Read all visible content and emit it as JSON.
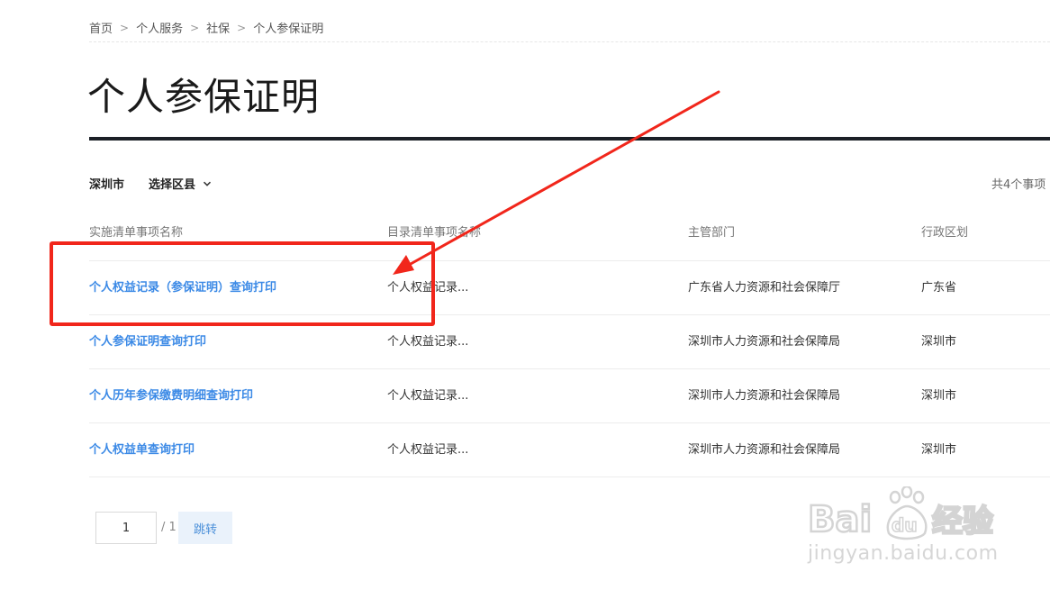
{
  "breadcrumb": {
    "items": [
      "首页",
      "个人服务",
      "社保",
      "个人参保证明"
    ],
    "separator": ">"
  },
  "page_title": "个人参保证明",
  "filters": {
    "city": "深圳市",
    "district_select": "选择区县",
    "total_count": "共4个事项"
  },
  "table": {
    "headers": [
      "实施清单事项名称",
      "目录清单事项名称",
      "主管部门",
      "行政区划"
    ],
    "rows": [
      [
        "个人权益记录（参保证明）查询打印",
        "个人权益记录...",
        "广东省人力资源和社会保障厅",
        "广东省"
      ],
      [
        "个人参保证明查询打印",
        "个人权益记录...",
        "深圳市人力资源和社会保障局",
        "深圳市"
      ],
      [
        "个人历年参保缴费明细查询打印",
        "个人权益记录...",
        "深圳市人力资源和社会保障局",
        "深圳市"
      ],
      [
        "个人权益单查询打印",
        "个人权益记录...",
        "深圳市人力资源和社会保障局",
        "深圳市"
      ]
    ]
  },
  "pagination": {
    "current_page": "1",
    "total_pages": "/ 1",
    "jump_label": "跳转"
  },
  "watermark": {
    "logo_text": "Bai du 经验",
    "url": "jingyan.baidu.com"
  },
  "colors": {
    "link": "#3c8ae6",
    "title_rule": "#1b2027",
    "annotation": "#f1261b",
    "jump_button_bg": "#eaf2fb"
  },
  "icons": {
    "district_dropdown": "chevron-down-icon",
    "breadcrumb_separator": "chevron-right-icon"
  }
}
